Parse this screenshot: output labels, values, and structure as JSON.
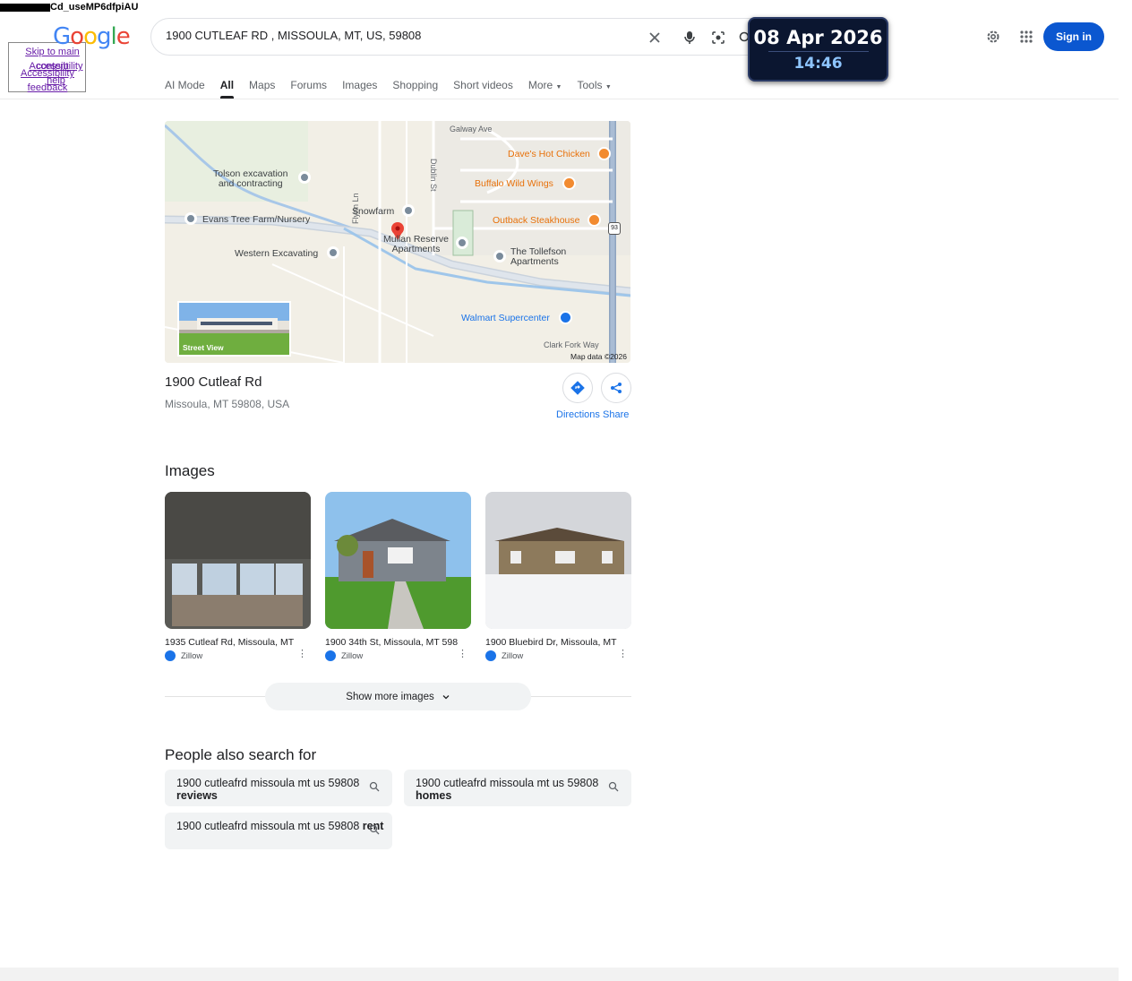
{
  "corner_text": "Cd_useMP6dfpiAU",
  "skip_links": [
    "Skip to main content",
    "Accessibility help",
    "Accessibility feedback"
  ],
  "logo": "Google",
  "search": {
    "value": "1900 CUTLEAF RD , MISSOULA, MT, US, 59808"
  },
  "date_widget": {
    "date": "08 Apr 2026",
    "time": "14:46"
  },
  "header": {
    "signin_label": "Sign in"
  },
  "tabs": [
    "AI Mode",
    "All",
    "Maps",
    "Forums",
    "Images",
    "Shopping",
    "Short videos",
    "More",
    "Tools"
  ],
  "map": {
    "labels": {
      "galway": "Galway Ave",
      "dublin": "Dublin St",
      "flynn": "Flynn Ln",
      "tolson": "Tolson excavation\nand contracting",
      "evans": "Evans Tree Farm/Nursery",
      "snowfarm": "Snowfarm",
      "mullan": "Mullan Reserve\nApartments",
      "western": "Western Excavating",
      "tollefson": "The Tollefson\nApartments",
      "daves": "Dave's Hot Chicken",
      "buffalo": "Buffalo Wild Wings",
      "outback": "Outback Steakhouse",
      "walmart": "Walmart Supercenter",
      "clarkfork": "Clark Fork Way",
      "route": "93"
    },
    "street_view": "Street View",
    "map_data": "Map data ©2026"
  },
  "place": {
    "title": "1900 Cutleaf Rd",
    "address": "Missoula, MT 59808, USA",
    "directions": "Directions",
    "share": "Share"
  },
  "images_section": {
    "heading": "Images",
    "items": [
      {
        "caption": "1935 Cutleaf Rd, Missoula, MT",
        "source": "Zillow"
      },
      {
        "caption": "1900 34th St, Missoula, MT 598",
        "source": "Zillow"
      },
      {
        "caption": "1900 Bluebird Dr, Missoula, MT",
        "source": "Zillow"
      }
    ],
    "show_more": "Show more images"
  },
  "people_also_search": {
    "heading": "People also search for",
    "items": [
      {
        "prefix": "1900 cutleafrd missoula mt us 59808 ",
        "bold": "reviews"
      },
      {
        "prefix": "1900 cutleafrd missoula mt us 59808 ",
        "bold": "homes"
      },
      {
        "prefix": "1900 cutleafrd missoula mt us 59808 ",
        "bold": "rent"
      }
    ]
  }
}
